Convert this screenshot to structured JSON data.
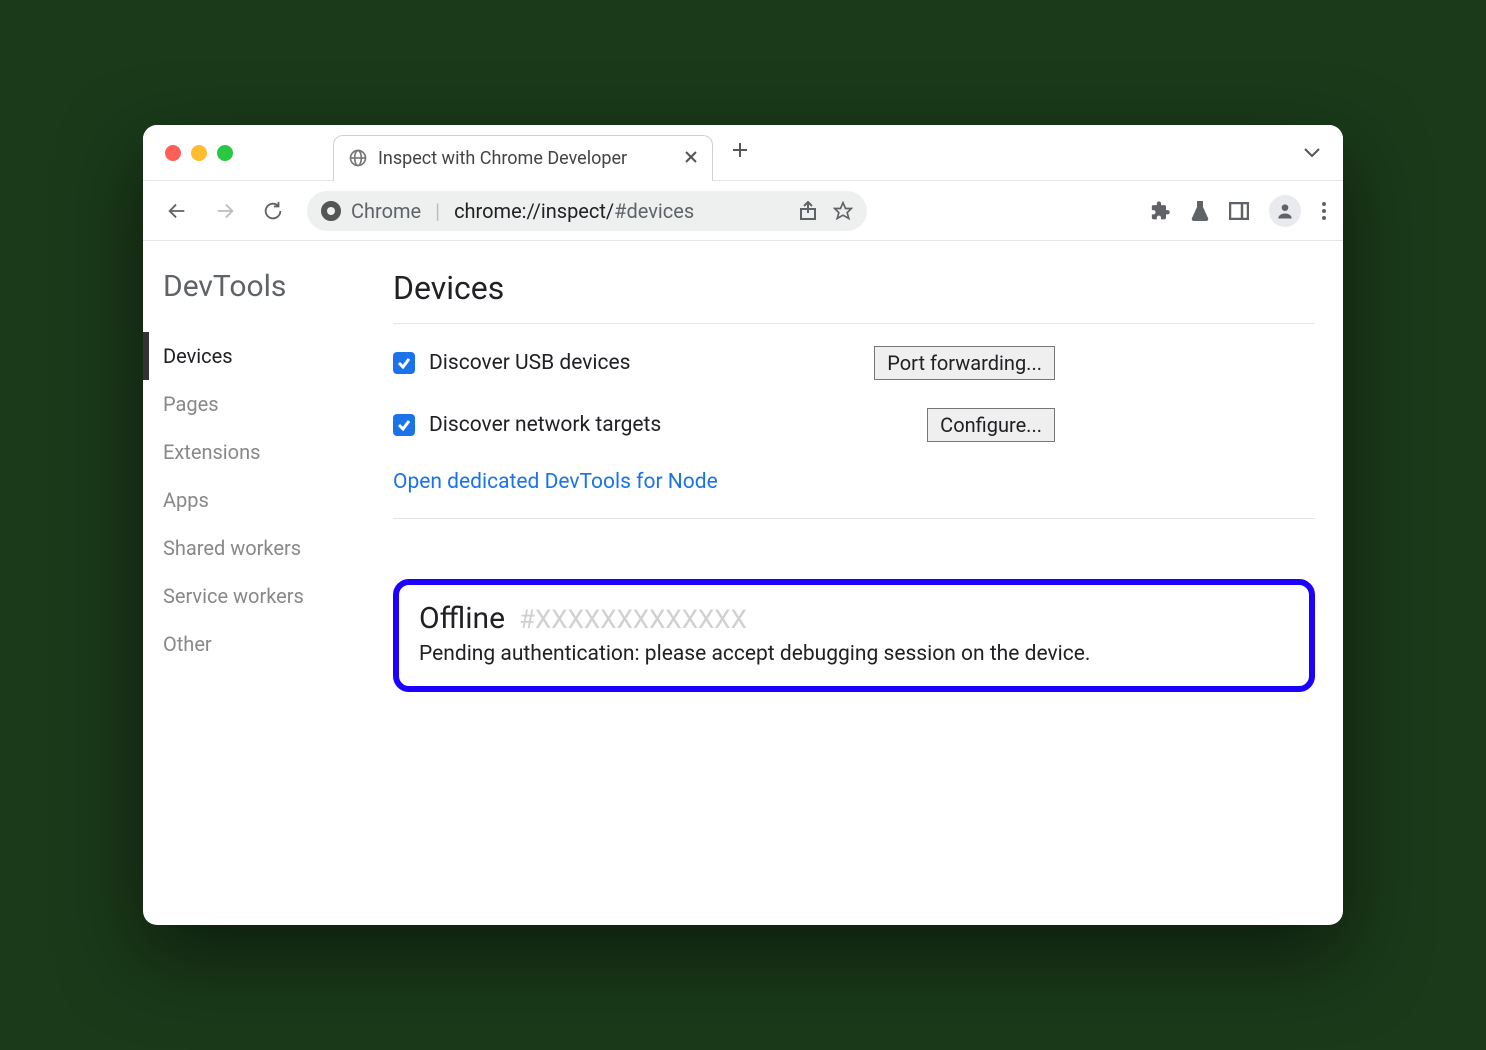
{
  "window": {
    "tab_title": "Inspect with Chrome Developer"
  },
  "toolbar": {
    "omnibox_label": "Chrome",
    "omnibox_url_main": "chrome://inspect/",
    "omnibox_url_hash": "#devices"
  },
  "sidebar": {
    "title": "DevTools",
    "items": [
      "Devices",
      "Pages",
      "Extensions",
      "Apps",
      "Shared workers",
      "Service workers",
      "Other"
    ],
    "active_index": 0
  },
  "main": {
    "title": "Devices",
    "discover_usb": {
      "label": "Discover USB devices",
      "checked": true,
      "button": "Port forwarding..."
    },
    "discover_net": {
      "label": "Discover network targets",
      "checked": true,
      "button": "Configure..."
    },
    "node_link": "Open dedicated DevTools for Node",
    "device": {
      "status": "Offline",
      "id": "#XXXXXXXXXXXXX",
      "message": "Pending authentication: please accept debugging session on the device."
    }
  }
}
